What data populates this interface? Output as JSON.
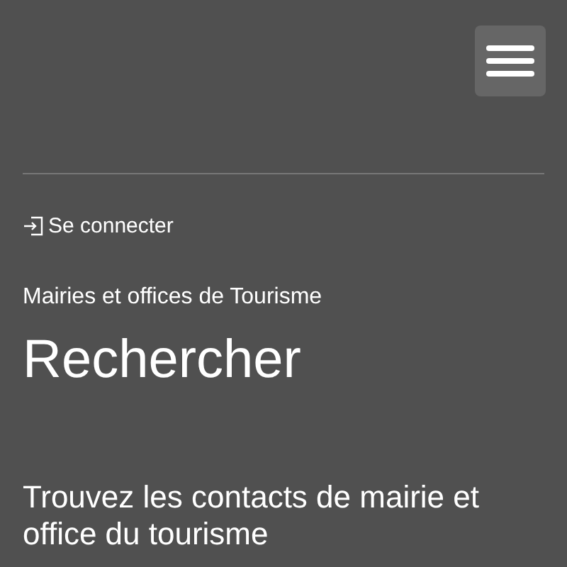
{
  "login_link": {
    "label": "Se connecter"
  },
  "breadcrumb": "Mairies et offices de Tourisme",
  "title": "Rechercher",
  "section_heading": "Trouvez les contacts de mairie et office du tourisme"
}
